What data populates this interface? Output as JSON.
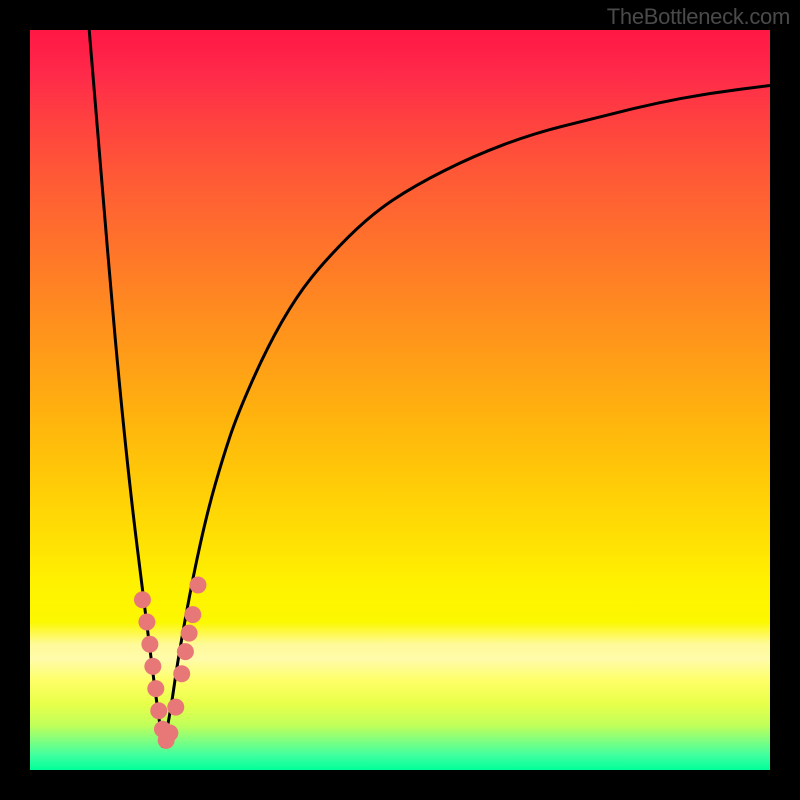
{
  "watermark": "TheBottleneck.com",
  "chart_data": {
    "type": "line",
    "title": "",
    "xlabel": "",
    "ylabel": "",
    "xlim": [
      0,
      100
    ],
    "ylim": [
      0,
      100
    ],
    "note": "Bottleneck curve: steep left branch descending to a minimum near x≈18, then rising right branch with diminishing slope. Background gradient maps bottleneck severity: red (high/bad) at top, through orange/yellow, to green (low/good) at bottom. Marker dots cluster around the valley floor where curve is in the low-severity band.",
    "series": [
      {
        "name": "left-branch",
        "x": [
          8,
          9,
          10,
          11,
          12,
          13,
          14,
          15,
          16,
          17,
          18
        ],
        "y": [
          100,
          88,
          76,
          64,
          53,
          43,
          34,
          26,
          18,
          10,
          3
        ]
      },
      {
        "name": "right-branch",
        "x": [
          18,
          19,
          20,
          22,
          24,
          26,
          28,
          32,
          36,
          40,
          46,
          52,
          60,
          68,
          76,
          84,
          92,
          100
        ],
        "y": [
          3,
          8,
          15,
          26,
          35,
          42,
          48,
          57,
          64,
          69,
          75,
          79,
          83,
          86,
          88,
          90,
          91.5,
          92.5
        ]
      }
    ],
    "markers": {
      "name": "bottleneck-points",
      "x": [
        15.2,
        15.8,
        16.2,
        16.6,
        17.0,
        17.4,
        17.9,
        18.4,
        18.9,
        19.7,
        20.5,
        21.0,
        21.5,
        22.0,
        22.7
      ],
      "y": [
        23,
        20,
        17,
        14,
        11,
        8,
        5.5,
        4,
        5,
        8.5,
        13,
        16,
        18.5,
        21,
        25
      ]
    },
    "gradient_stops": [
      {
        "pos": 0,
        "color": "#ff1744"
      },
      {
        "pos": 50,
        "color": "#ffb400"
      },
      {
        "pos": 78,
        "color": "#fff200"
      },
      {
        "pos": 100,
        "color": "#00ff99"
      }
    ]
  }
}
